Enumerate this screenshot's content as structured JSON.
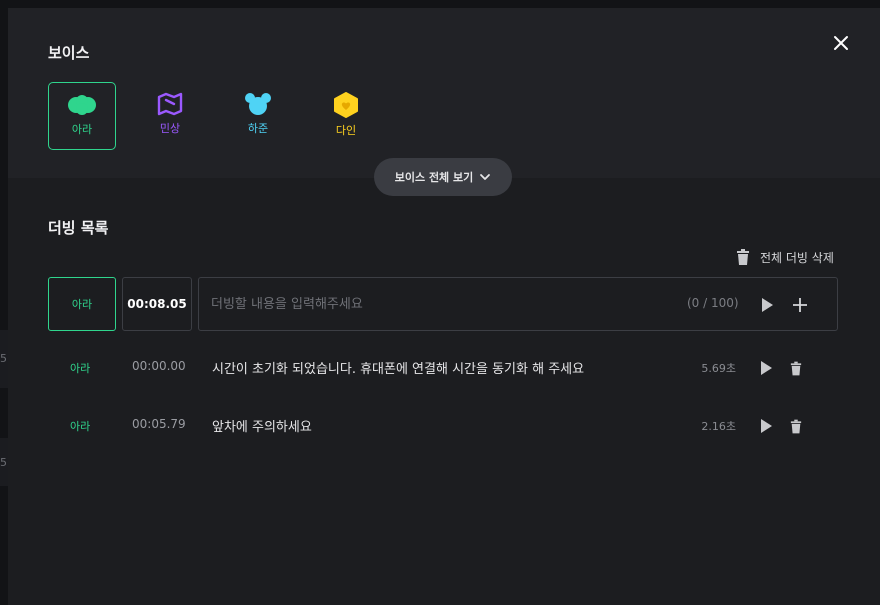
{
  "background": {
    "edge_texts": [
      "5",
      "5"
    ]
  },
  "voice_section": {
    "title": "보이스",
    "voices": [
      {
        "name": "아라",
        "color": "#2fd58d",
        "icon": "cloud-icon",
        "selected": true
      },
      {
        "name": "민상",
        "color": "#9b59ff",
        "icon": "map-icon",
        "selected": false
      },
      {
        "name": "하준",
        "color": "#4fd3f5",
        "icon": "bear-icon",
        "selected": false
      },
      {
        "name": "다인",
        "color": "#ffd21f",
        "icon": "hexagon-heart-icon",
        "selected": false
      }
    ],
    "view_all_label": "보이스 전체 보기"
  },
  "dubbing": {
    "title": "더빙 목록",
    "delete_all_label": "전체 더빙 삭제",
    "input": {
      "voice": "아라",
      "time": "00:08.05",
      "placeholder": "더빙할 내용을 입력해주세요",
      "value": "",
      "char_count": "(0 / 100)"
    },
    "items": [
      {
        "voice": "아라",
        "time": "00:00.00",
        "text": "시간이 초기화 되었습니다. 휴대폰에 연결해 시간을 동기화 해 주세요",
        "duration": "5.69초"
      },
      {
        "voice": "아라",
        "time": "00:05.79",
        "text": "앞차에 주의하세요",
        "duration": "2.16초"
      }
    ]
  },
  "colors": {
    "accent": "#2fd58d",
    "modal_bg": "#1c1d20",
    "voice_section_bg": "#212226"
  }
}
